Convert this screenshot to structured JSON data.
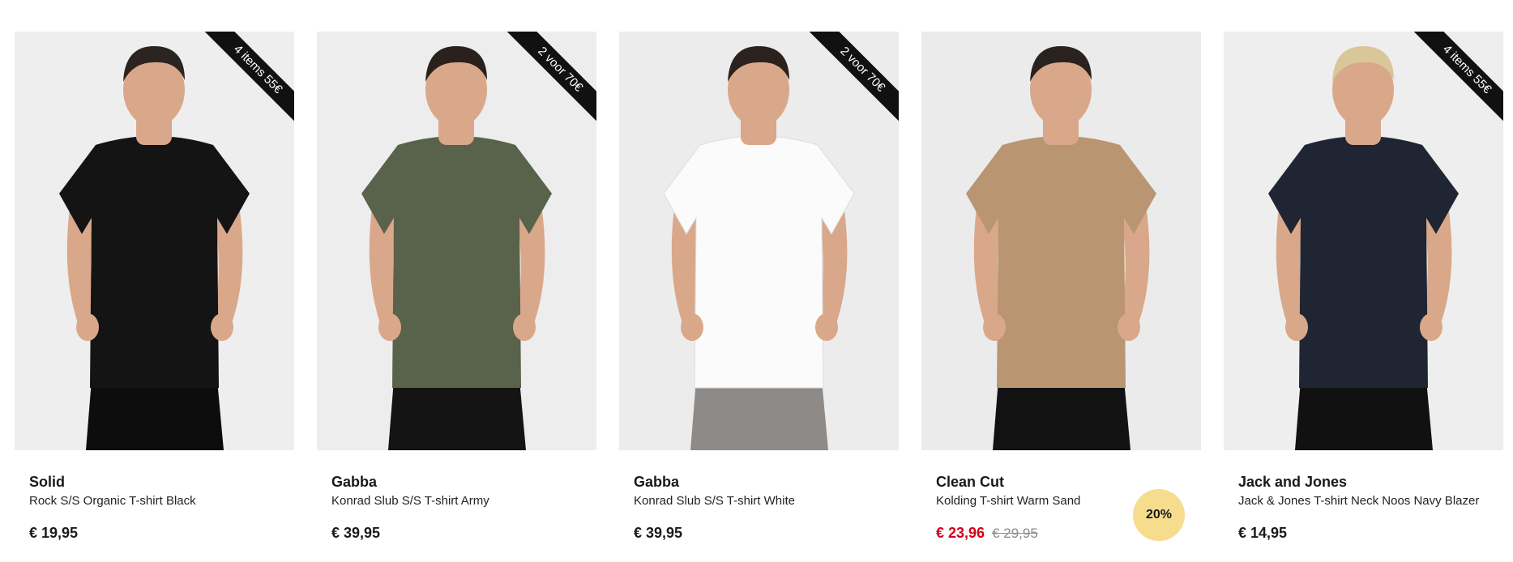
{
  "products": [
    {
      "brand": "Solid",
      "name": "Rock S/S Organic T-shirt Black",
      "price": "€ 19,95",
      "ribbon": "4 items 55€",
      "shirt_color": "#141414",
      "pants_color": "#0d0d0d",
      "hair_color": "#2b2421",
      "bg": "#eeeeee"
    },
    {
      "brand": "Gabba",
      "name": "Konrad Slub S/S T-shirt Army",
      "price": "€ 39,95",
      "ribbon": "2 voor 70€",
      "shirt_color": "#59624a",
      "pants_color": "#141414",
      "hair_color": "#2a211c",
      "bg": "#ededed"
    },
    {
      "brand": "Gabba",
      "name": "Konrad Slub S/S T-shirt White",
      "price": "€ 39,95",
      "ribbon": "2 voor 70€",
      "shirt_color": "#fbfbfb",
      "pants_color": "#8e8a87",
      "hair_color": "#2b221d",
      "bg": "#ececec"
    },
    {
      "brand": "Clean Cut",
      "name": "Kolding T-shirt Warm Sand",
      "price": "€ 23,96",
      "old_price": "€ 29,95",
      "badge": "20%",
      "shirt_color": "#b99572",
      "pants_color": "#121212",
      "hair_color": "#2a221e",
      "bg": "#ebebeb"
    },
    {
      "brand": "Jack and Jones",
      "name": "Jack & Jones T-shirt Neck Noos Navy Blazer",
      "price": "€ 14,95",
      "ribbon": "4 items 55€",
      "shirt_color": "#1f2533",
      "pants_color": "#111111",
      "hair_color": "#d9c79a",
      "bg": "#eeeeee"
    }
  ],
  "colors": {
    "sale": "#d0021b",
    "badge_bg": "#f6dc8d",
    "ribbon_bg": "#111111"
  }
}
